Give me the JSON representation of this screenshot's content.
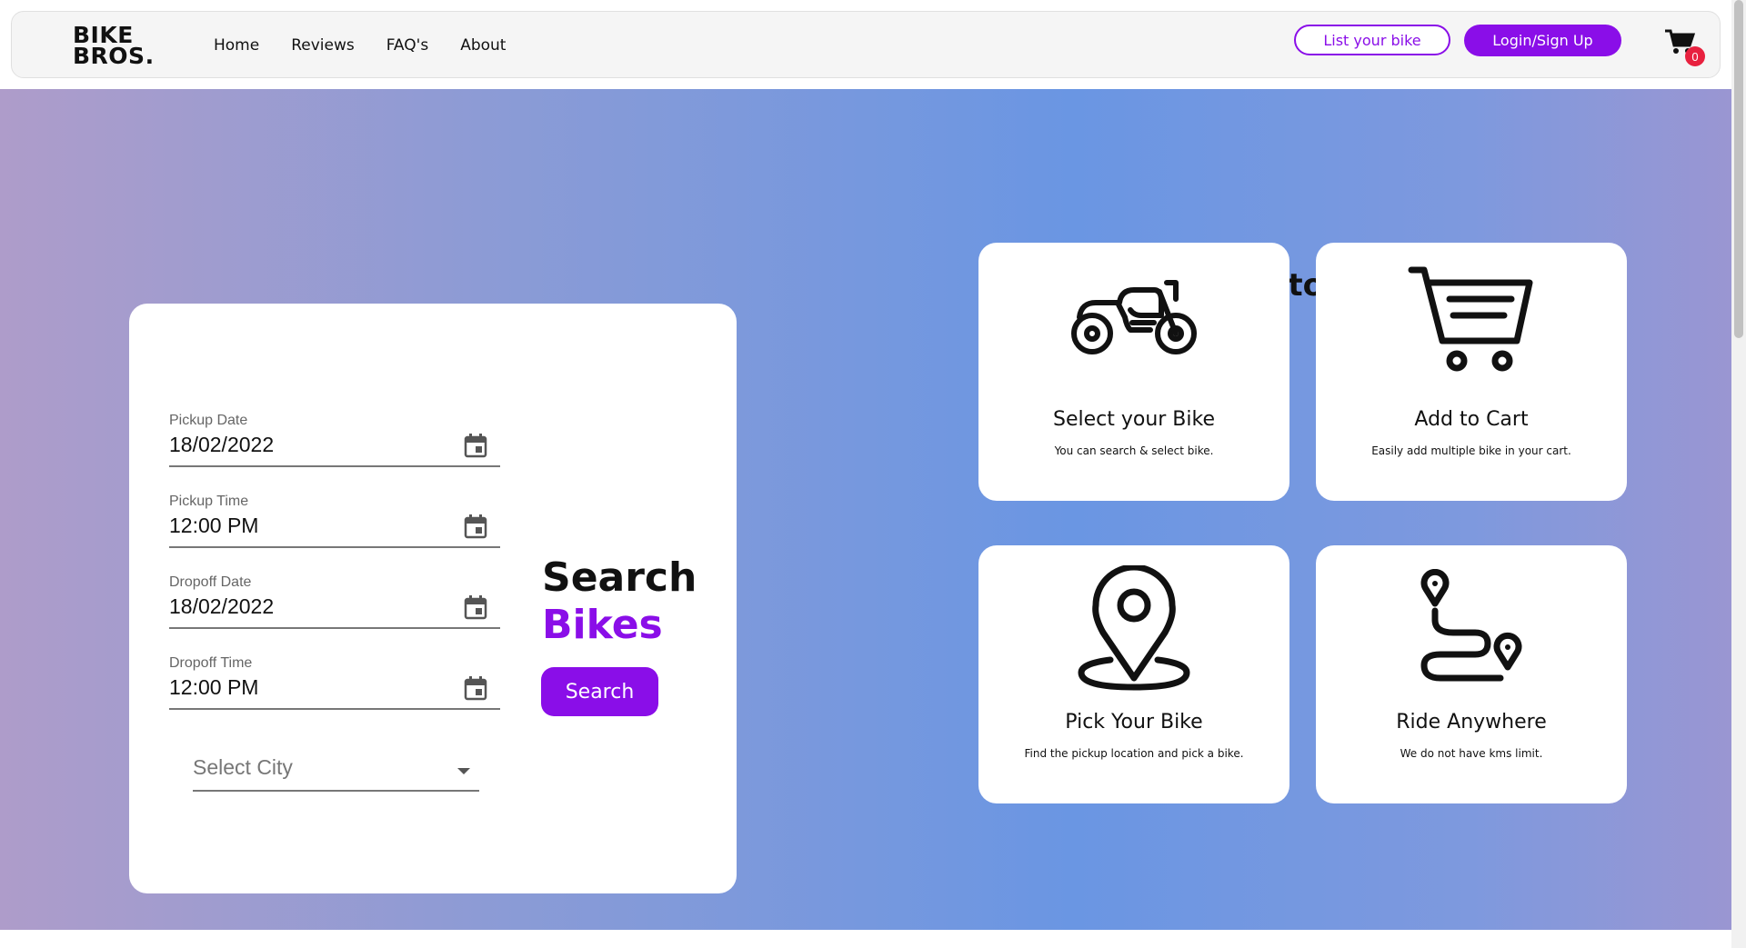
{
  "brand": {
    "line1": "BIKE",
    "line2": "BROS."
  },
  "nav": {
    "links": [
      "Home",
      "Reviews",
      "FAQ's",
      "About"
    ]
  },
  "header": {
    "list_bike_label": "List your bike",
    "login_label": "Login/Sign Up",
    "cart_count": "0"
  },
  "search_form": {
    "fields": [
      {
        "label": "Pickup Date",
        "value": "18/02/2022"
      },
      {
        "label": "Pickup Time",
        "value": "12:00 PM"
      },
      {
        "label": "Dropoff Date",
        "value": "18/02/2022"
      },
      {
        "label": "Dropoff Time",
        "value": "12:00 PM"
      }
    ],
    "city_placeholder": "Select City",
    "title_line1": "Search",
    "title_line2": "Bikes",
    "search_button": "Search"
  },
  "how_to_use": {
    "title": "How to Use",
    "steps": [
      {
        "icon": "motorcycle-icon",
        "title": "Select your Bike",
        "desc": "You can search & select bike."
      },
      {
        "icon": "shopping-cart-icon",
        "title": "Add to Cart",
        "desc": "Easily add multiple bike in your cart."
      },
      {
        "icon": "location-pin-icon",
        "title": "Pick Your Bike",
        "desc": "Find the pickup location and pick a bike."
      },
      {
        "icon": "route-icon",
        "title": "Ride Anywhere",
        "desc": "We do not have kms limit."
      }
    ]
  },
  "colors": {
    "accent": "#8a0ee8",
    "badge": "#e8213f"
  }
}
